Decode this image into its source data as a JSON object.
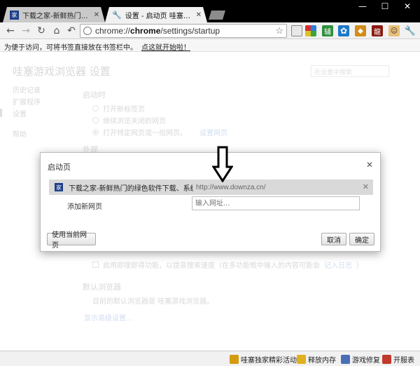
{
  "browser": {
    "tabs": [
      {
        "title": "下载之家-新鲜热门的绿色",
        "favicon": "家",
        "active": false
      },
      {
        "title": "设置 - 启动页 哇塞游戏浏览",
        "favicon": "wrench-icon",
        "active": true
      }
    ],
    "address": {
      "prefix": "chrome://",
      "host": "chrome",
      "path": "/settings/startup"
    },
    "extensions": [
      "window-icon",
      "grid-icon",
      "辅",
      "gear-icon",
      "game-icon",
      "龍",
      "user-icon",
      "wrench-icon"
    ],
    "bookmark_hint": "为便于访问，可将书签直接放在书签栏中。",
    "bookmark_link": "点这就开始啦！"
  },
  "settings": {
    "title": "哇塞游戏浏览器 设置",
    "search_placeholder": "在设置中搜索",
    "nav": [
      "历史记录",
      "扩展程序",
      "设置",
      "帮助"
    ],
    "startup_heading": "启动时",
    "startup_options": [
      "打开新标签页",
      "继续浏览关闭的网页",
      "打开特定网页或一组网页。"
    ],
    "set_pages_link": "设置网页",
    "appearance_heading": "外观",
    "instant_checkbox": "启用即搜即得功能，以提高搜索速度（在多功能框中输入的内容可能会",
    "instant_link": "记入日志",
    "default_browser_heading": "默认浏览器",
    "default_browser_text": "目前的默认浏览器是 哇塞游戏浏览器。",
    "advanced_link": "显示高级设置..."
  },
  "dialog": {
    "title": "启动页",
    "page_entry": {
      "title": "下载之家-新鲜热门的绿色软件下载、系统...",
      "url": "http://www.downza.cn/",
      "favicon": "家"
    },
    "add_label": "添加新网页",
    "add_placeholder": "输入网址...",
    "use_current_button": "使用当前网页",
    "cancel_button": "取消",
    "ok_button": "确定"
  },
  "statusbar": [
    {
      "label": "哇塞独家精彩活动",
      "icon": "trophy-icon",
      "color": "#d49a10"
    },
    {
      "label": "释放内存",
      "icon": "broom-icon",
      "color": "#e0b020"
    },
    {
      "label": "游戏修复",
      "icon": "wrench-icon",
      "color": "#4a6fb5"
    },
    {
      "label": "开服表",
      "icon": "server-list-icon",
      "color": "#c0392b"
    }
  ]
}
